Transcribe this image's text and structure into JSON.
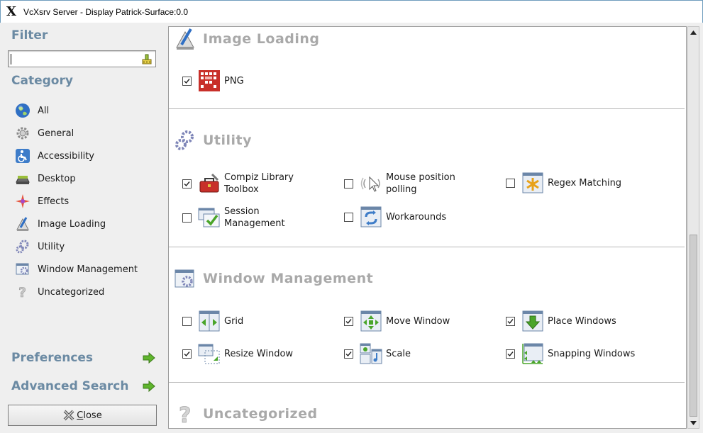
{
  "window": {
    "title": "VcXsrv Server - Display Patrick-Surface:0.0"
  },
  "sidebar": {
    "filter_heading": "Filter",
    "filter_value": "",
    "category_heading": "Category",
    "categories": [
      {
        "label": "All",
        "icon": "globe-icon"
      },
      {
        "label": "General",
        "icon": "gear-icon"
      },
      {
        "label": "Accessibility",
        "icon": "wheelchair-icon"
      },
      {
        "label": "Desktop",
        "icon": "desktop-icon"
      },
      {
        "label": "Effects",
        "icon": "sparkle-icon"
      },
      {
        "label": "Image Loading",
        "icon": "image-loading-icon"
      },
      {
        "label": "Utility",
        "icon": "utility-gears-icon"
      },
      {
        "label": "Window Management",
        "icon": "window-management-icon"
      },
      {
        "label": "Uncategorized",
        "icon": "question-icon"
      }
    ],
    "preferences_label": "Preferences",
    "advanced_search_label": "Advanced Search",
    "close_label_first": "C",
    "close_label_rest": "lose"
  },
  "sections": {
    "image_loading": {
      "title": "Image Loading",
      "plugins": [
        {
          "label": "PNG",
          "checked": true
        }
      ]
    },
    "utility": {
      "title": "Utility",
      "plugins": [
        {
          "label": "Compiz Library Toolbox",
          "checked": true
        },
        {
          "label": "Mouse position polling",
          "checked": false
        },
        {
          "label": "Regex Matching",
          "checked": false
        },
        {
          "label": "Session Management",
          "checked": false
        },
        {
          "label": "Workarounds",
          "checked": false
        }
      ]
    },
    "window_management": {
      "title": "Window Management",
      "plugins": [
        {
          "label": "Grid",
          "checked": false
        },
        {
          "label": "Move Window",
          "checked": true
        },
        {
          "label": "Place Windows",
          "checked": true
        },
        {
          "label": "Resize Window",
          "checked": true
        },
        {
          "label": "Scale",
          "checked": true
        },
        {
          "label": "Snapping Windows",
          "checked": true
        }
      ]
    },
    "uncategorized": {
      "title": "Uncategorized"
    }
  },
  "colors": {
    "heading": "#6b8aa3",
    "section_title": "#a9a9a9",
    "accent_green": "#5fb52d"
  }
}
